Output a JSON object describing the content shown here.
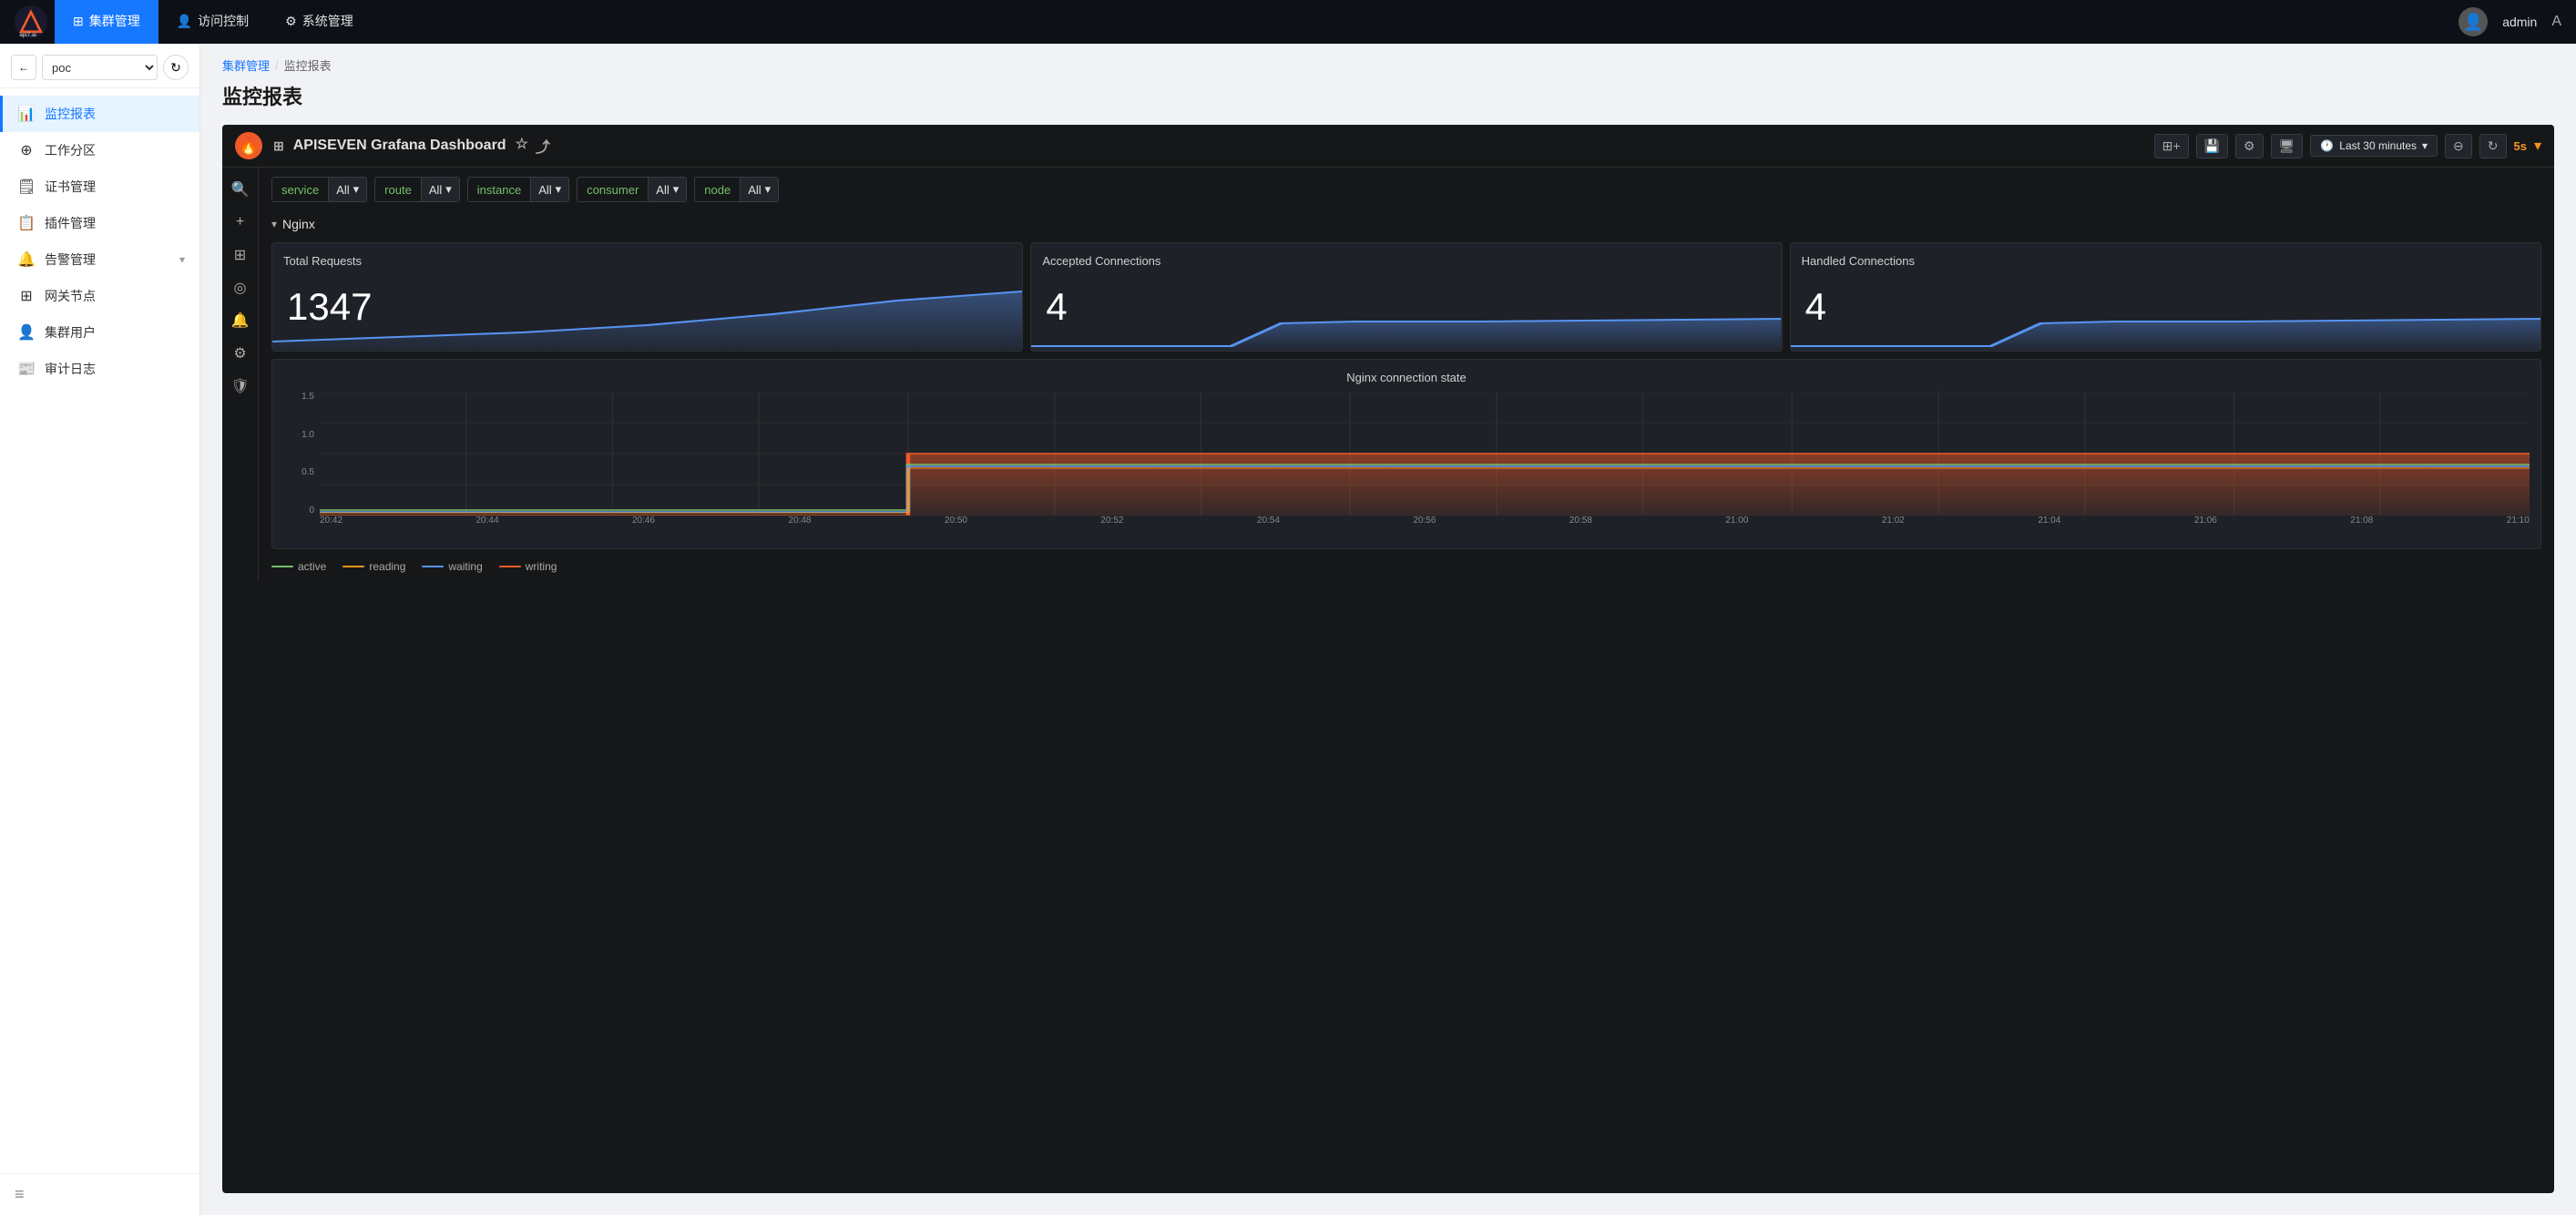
{
  "topNav": {
    "logo_alt": "API7.ai",
    "items": [
      {
        "label": "集群管理",
        "active": true,
        "icon": "⊞"
      },
      {
        "label": "访问控制",
        "active": false,
        "icon": "👤"
      },
      {
        "label": "系统管理",
        "active": false,
        "icon": "⚙"
      }
    ],
    "user": {
      "name": "admin"
    },
    "lang": "A"
  },
  "sidebar": {
    "cluster_select": "poc",
    "menu": [
      {
        "label": "监控报表",
        "icon": "📊",
        "active": true
      },
      {
        "label": "工作分区",
        "icon": "⊕"
      },
      {
        "label": "证书管理",
        "icon": "🗒"
      },
      {
        "label": "插件管理",
        "icon": "📋"
      },
      {
        "label": "告警管理",
        "icon": "🔔",
        "hasArrow": true
      },
      {
        "label": "网关节点",
        "icon": "⊞"
      },
      {
        "label": "集群用户",
        "icon": "👤"
      },
      {
        "label": "审计日志",
        "icon": "📰"
      }
    ],
    "bottom_icon": "≡"
  },
  "breadcrumb": {
    "parent": "集群管理",
    "current": "监控报表",
    "sep": "/"
  },
  "pageTitle": "监控报表",
  "grafana": {
    "logo": "🔥",
    "title": "APISEVEN Grafana Dashboard",
    "icons": {
      "grid": "⊞",
      "star": "☆",
      "share": "⤴"
    },
    "toolbar": {
      "addPanel": "+",
      "save": "💾",
      "settings": "⚙",
      "display": "🖥",
      "timeRange": "Last 30 minutes",
      "zoomOut": "⊖",
      "refresh": "↻",
      "rate": "5s"
    },
    "filters": [
      {
        "label": "service",
        "value": "All"
      },
      {
        "label": "route",
        "value": "All"
      },
      {
        "label": "instance",
        "value": "All"
      },
      {
        "label": "consumer",
        "value": "All"
      },
      {
        "label": "node",
        "value": "All"
      }
    ],
    "nginx": {
      "section_label": "Nginx",
      "panels": [
        {
          "title": "Total Requests",
          "value": "1347"
        },
        {
          "title": "Accepted Connections",
          "value": "4"
        },
        {
          "title": "Handled Connections",
          "value": "4"
        }
      ],
      "connectionState": {
        "title": "Nginx connection state",
        "yLabels": [
          "1.5",
          "1.0",
          "0.5",
          "0"
        ],
        "xLabels": [
          "20:42",
          "20:44",
          "20:46",
          "20:48",
          "20:50",
          "20:52",
          "20:54",
          "20:56",
          "20:58",
          "21:00",
          "21:02",
          "21:04",
          "21:06",
          "21:08",
          "21:10"
        ],
        "legend": [
          {
            "label": "active",
            "color": "#73bf69"
          },
          {
            "label": "reading",
            "color": "#f79520"
          },
          {
            "label": "waiting",
            "color": "#5794f2"
          },
          {
            "label": "writing",
            "color": "#f05a28"
          }
        ]
      }
    },
    "leftSidebar": {
      "icons": [
        "🔍",
        "+",
        "⊞",
        "◎",
        "🔔",
        "⚙",
        "🛡"
      ]
    }
  }
}
